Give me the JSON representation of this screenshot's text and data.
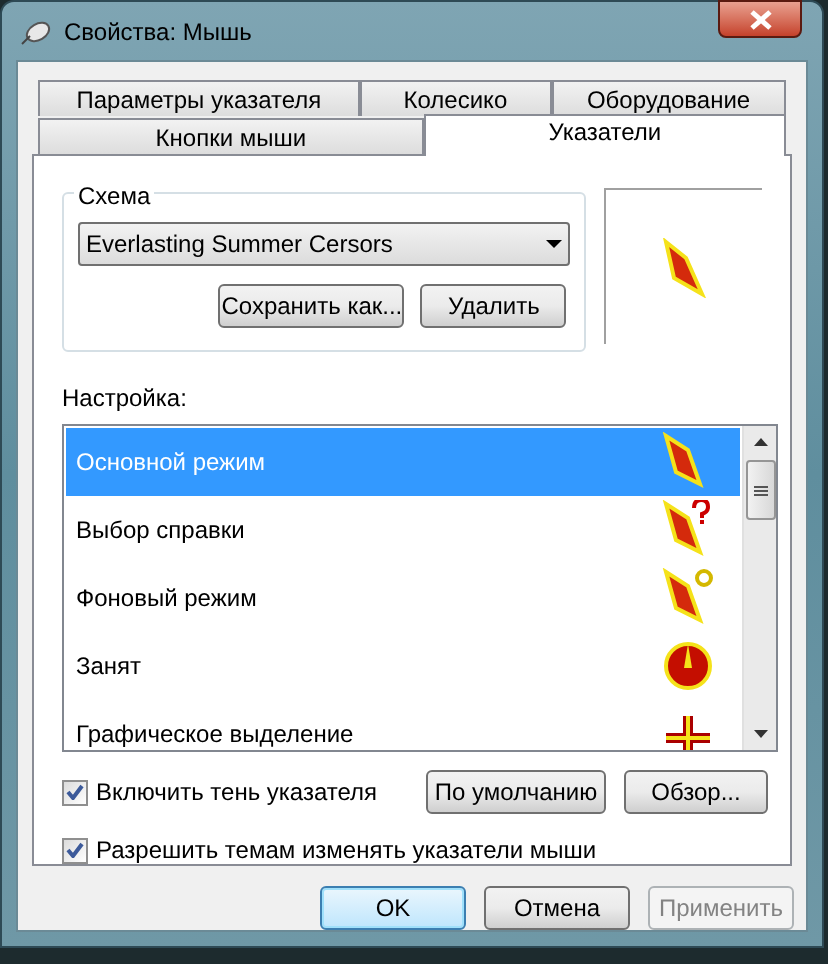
{
  "window": {
    "title": "Свойства: Мышь"
  },
  "tab_rows": [
    [
      {
        "label": "Параметры указателя",
        "selected": false
      },
      {
        "label": "Колесико",
        "selected": false
      },
      {
        "label": "Оборудование",
        "selected": false
      }
    ],
    [
      {
        "label": "Кнопки мыши",
        "selected": false
      },
      {
        "label": "Указатели",
        "selected": true
      }
    ]
  ],
  "scheme": {
    "label": "Схема",
    "value": "Everlasting Summer Cersors",
    "buttons": [
      "Сохранить как...",
      "Удалить"
    ]
  },
  "customize": {
    "label": "Настройка:",
    "items": [
      {
        "label": "Основной режим",
        "selected": true,
        "kind": "normal"
      },
      {
        "label": "Выбор справки",
        "selected": false,
        "kind": "help"
      },
      {
        "label": "Фоновый режим",
        "selected": false,
        "kind": "working"
      },
      {
        "label": "Занят",
        "selected": false,
        "kind": "busy"
      },
      {
        "label": "Графическое выделение",
        "selected": false,
        "kind": "precision"
      }
    ]
  },
  "checkboxes": [
    {
      "label": "Включить тень указателя",
      "checked": true
    },
    {
      "label": "Разрешить темам изменять указатели мыши",
      "checked": true
    }
  ],
  "side_buttons": [
    "По умолчанию",
    "Обзор..."
  ],
  "dialog_buttons": [
    {
      "label": "OK",
      "default": true,
      "disabled": false
    },
    {
      "label": "Отмена",
      "default": false,
      "disabled": false
    },
    {
      "label": "Применить",
      "default": false,
      "disabled": true
    }
  ]
}
